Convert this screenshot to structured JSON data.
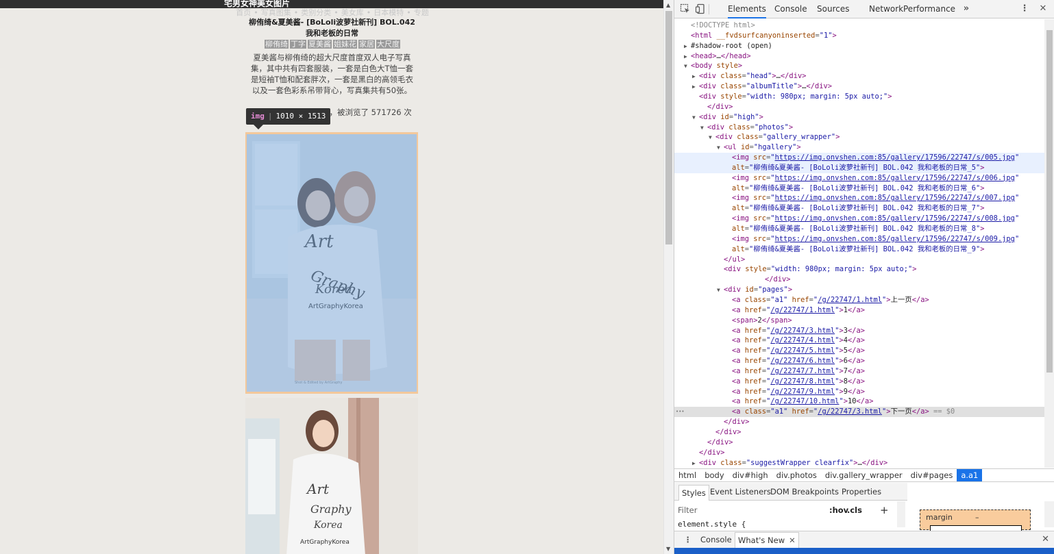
{
  "site": {
    "title": "宅男女神美女图片",
    "nav": [
      "首页",
      "写真图集",
      "类别分类",
      "美女库",
      "日本模特",
      "专题"
    ]
  },
  "album": {
    "title": "柳侑绮&夏美酱- [BoLoli波萝社新刊] BOL.042 我和老板的日常",
    "tags": [
      "柳侑绮",
      "丁字",
      "夏美酱",
      "姐妹花",
      "家居",
      "大尺度"
    ],
    "description": "夏美酱与柳侑绮的超大尺度首度双人电子写真集，其中共有四套服装，一套是白色大T恤一套是短袖T恤和配套胖次，一套是黑白的高领毛衣以及一套色彩系吊带背心，写真集共有50张。",
    "meta": "，在 2017/5/17 创建，被浏览了 571726 次"
  },
  "photos": [
    {
      "watermark": "ArtGraphyKorea",
      "credit": "Shot & Edited by ArtGraphy"
    },
    {
      "watermark": "ArtGraphyKorea"
    }
  ],
  "tooltip": {
    "tag": "img",
    "size": "1010 × 1513"
  },
  "devtools": {
    "tabs": [
      "Elements",
      "Console",
      "Sources",
      "Network",
      "Performance"
    ],
    "active_tab": "Elements",
    "more_icon": "»",
    "kebab_icon": "⋮",
    "close_icon": "✕",
    "dom_lines": [
      {
        "indent": 0,
        "tw": "",
        "html": "<span class=\"cm\">&lt;!DOCTYPE html&gt;</span>"
      },
      {
        "indent": 0,
        "tw": "",
        "html": "<span class=\"t\">&lt;html</span> <span class=\"an\">__fvdsurfcanyoninserted</span><span class=\"eq\">=</span><span class=\"av\">\"1\"</span><span class=\"t\">&gt;</span>"
      },
      {
        "indent": 0,
        "tw": "▶",
        "html": "<span class=\"tx\">#shadow-root (open)</span>"
      },
      {
        "indent": 0,
        "tw": "▶",
        "html": "<span class=\"t\">&lt;head&gt;</span><span class=\"tx\">…</span><span class=\"t\">&lt;/head&gt;</span>"
      },
      {
        "indent": 0,
        "tw": "▼",
        "html": "<span class=\"t\">&lt;body</span> <span class=\"an\">style</span><span class=\"t\">&gt;</span>"
      },
      {
        "indent": 1,
        "tw": "▶",
        "html": "<span class=\"t\">&lt;div</span> <span class=\"an\">class</span><span class=\"eq\">=</span><span class=\"av\">\"head\"</span><span class=\"t\">&gt;</span><span class=\"tx\">…</span><span class=\"t\">&lt;/div&gt;</span>"
      },
      {
        "indent": 1,
        "tw": "▶",
        "html": "<span class=\"t\">&lt;div</span> <span class=\"an\">class</span><span class=\"eq\">=</span><span class=\"av\">\"albumTitle\"</span><span class=\"t\">&gt;</span><span class=\"tx\">…</span><span class=\"t\">&lt;/div&gt;</span>"
      },
      {
        "indent": 1,
        "tw": "",
        "html": "<span class=\"t\">&lt;div</span> <span class=\"an\">style</span><span class=\"eq\">=</span><span class=\"av\">\"width: 980px; margin: 5px auto;\"</span><span class=\"t\">&gt;</span>"
      },
      {
        "indent": 2,
        "tw": "",
        "html": "<span class=\"t\">&lt;/div&gt;</span>"
      },
      {
        "indent": 1,
        "tw": "▼",
        "html": "<span class=\"t\">&lt;div</span> <span class=\"an\">id</span><span class=\"eq\">=</span><span class=\"av\">\"high\"</span><span class=\"t\">&gt;</span>"
      },
      {
        "indent": 2,
        "tw": "▼",
        "html": "<span class=\"t\">&lt;div</span> <span class=\"an\">class</span><span class=\"eq\">=</span><span class=\"av\">\"photos\"</span><span class=\"t\">&gt;</span>"
      },
      {
        "indent": 3,
        "tw": "▼",
        "html": "<span class=\"t\">&lt;div</span> <span class=\"an\">class</span><span class=\"eq\">=</span><span class=\"av\">\"gallery_wrapper\"</span><span class=\"t\">&gt;</span>"
      },
      {
        "indent": 4,
        "tw": "▼",
        "html": "<span class=\"t\">&lt;ul</span> <span class=\"an\">id</span><span class=\"eq\">=</span><span class=\"av\">\"hgallery\"</span><span class=\"t\">&gt;</span>"
      },
      {
        "indent": 5,
        "tw": "",
        "hov": true,
        "html": "<span class=\"t\">&lt;img</span> <span class=\"an\">src</span><span class=\"eq\">=</span><span class=\"av\">\"</span><span class=\"lk\">https://img.onvshen.com:85/gallery/17596/22747/s/005.jpg</span><span class=\"av\">\"</span>"
      },
      {
        "indent": 5,
        "tw": "",
        "hov": true,
        "html": "<span class=\"an\">alt</span><span class=\"eq\">=</span><span class=\"av\">\"柳侑绮&amp;夏美酱- [BoLoli波萝社新刊] BOL.042 我和老板的日常_5\"</span><span class=\"t\">&gt;</span>"
      },
      {
        "indent": 5,
        "tw": "",
        "html": "<span class=\"t\">&lt;img</span> <span class=\"an\">src</span><span class=\"eq\">=</span><span class=\"av\">\"</span><span class=\"lk\">https://img.onvshen.com:85/gallery/17596/22747/s/006.jpg</span><span class=\"av\">\"</span>"
      },
      {
        "indent": 5,
        "tw": "",
        "html": "<span class=\"an\">alt</span><span class=\"eq\">=</span><span class=\"av\">\"柳侑绮&amp;夏美酱- [BoLoli波萝社新刊] BOL.042 我和老板的日常_6\"</span><span class=\"t\">&gt;</span>"
      },
      {
        "indent": 5,
        "tw": "",
        "html": "<span class=\"t\">&lt;img</span> <span class=\"an\">src</span><span class=\"eq\">=</span><span class=\"av\">\"</span><span class=\"lk\">https://img.onvshen.com:85/gallery/17596/22747/s/007.jpg</span><span class=\"av\">\"</span>"
      },
      {
        "indent": 5,
        "tw": "",
        "html": "<span class=\"an\">alt</span><span class=\"eq\">=</span><span class=\"av\">\"柳侑绮&amp;夏美酱- [BoLoli波萝社新刊] BOL.042 我和老板的日常_7\"</span><span class=\"t\">&gt;</span>"
      },
      {
        "indent": 5,
        "tw": "",
        "html": "<span class=\"t\">&lt;img</span> <span class=\"an\">src</span><span class=\"eq\">=</span><span class=\"av\">\"</span><span class=\"lk\">https://img.onvshen.com:85/gallery/17596/22747/s/008.jpg</span><span class=\"av\">\"</span>"
      },
      {
        "indent": 5,
        "tw": "",
        "html": "<span class=\"an\">alt</span><span class=\"eq\">=</span><span class=\"av\">\"柳侑绮&amp;夏美酱- [BoLoli波萝社新刊] BOL.042 我和老板的日常_8\"</span><span class=\"t\">&gt;</span>"
      },
      {
        "indent": 5,
        "tw": "",
        "html": "<span class=\"t\">&lt;img</span> <span class=\"an\">src</span><span class=\"eq\">=</span><span class=\"av\">\"</span><span class=\"lk\">https://img.onvshen.com:85/gallery/17596/22747/s/009.jpg</span><span class=\"av\">\"</span>"
      },
      {
        "indent": 5,
        "tw": "",
        "html": "<span class=\"an\">alt</span><span class=\"eq\">=</span><span class=\"av\">\"柳侑绮&amp;夏美酱- [BoLoli波萝社新刊] BOL.042 我和老板的日常_9\"</span><span class=\"t\">&gt;</span>"
      },
      {
        "indent": 4,
        "tw": "",
        "html": "<span class=\"t\">&lt;/ul&gt;</span>"
      },
      {
        "indent": 4,
        "tw": "",
        "html": "<span class=\"t\">&lt;div</span> <span class=\"an\">style</span><span class=\"eq\">=</span><span class=\"av\">\"width: 980px; margin: 5px auto;\"</span><span class=\"t\">&gt;</span>"
      },
      {
        "indent": 9,
        "tw": "",
        "html": "<span class=\"t\">&lt;/div&gt;</span>"
      },
      {
        "indent": 4,
        "tw": "▼",
        "html": "<span class=\"t\">&lt;div</span> <span class=\"an\">id</span><span class=\"eq\">=</span><span class=\"av\">\"pages\"</span><span class=\"t\">&gt;</span>"
      },
      {
        "indent": 5,
        "tw": "",
        "html": "<span class=\"t\">&lt;a</span> <span class=\"an\">class</span><span class=\"eq\">=</span><span class=\"av\">\"a1\"</span> <span class=\"an\">href</span><span class=\"eq\">=</span><span class=\"av\">\"</span><span class=\"lk\">/g/22747/1.html</span><span class=\"av\">\"</span><span class=\"t\">&gt;</span><span class=\"tx\">上一页</span><span class=\"t\">&lt;/a&gt;</span>"
      },
      {
        "indent": 5,
        "tw": "",
        "html": "<span class=\"t\">&lt;a</span> <span class=\"an\">href</span><span class=\"eq\">=</span><span class=\"av\">\"</span><span class=\"lk\">/g/22747/1.html</span><span class=\"av\">\"</span><span class=\"t\">&gt;</span><span class=\"tx\">1</span><span class=\"t\">&lt;/a&gt;</span>"
      },
      {
        "indent": 5,
        "tw": "",
        "html": "<span class=\"t\">&lt;span&gt;</span><span class=\"tx\">2</span><span class=\"t\">&lt;/span&gt;</span>"
      },
      {
        "indent": 5,
        "tw": "",
        "html": "<span class=\"t\">&lt;a</span> <span class=\"an\">href</span><span class=\"eq\">=</span><span class=\"av\">\"</span><span class=\"lk\">/g/22747/3.html</span><span class=\"av\">\"</span><span class=\"t\">&gt;</span><span class=\"tx\">3</span><span class=\"t\">&lt;/a&gt;</span>"
      },
      {
        "indent": 5,
        "tw": "",
        "html": "<span class=\"t\">&lt;a</span> <span class=\"an\">href</span><span class=\"eq\">=</span><span class=\"av\">\"</span><span class=\"lk\">/g/22747/4.html</span><span class=\"av\">\"</span><span class=\"t\">&gt;</span><span class=\"tx\">4</span><span class=\"t\">&lt;/a&gt;</span>"
      },
      {
        "indent": 5,
        "tw": "",
        "html": "<span class=\"t\">&lt;a</span> <span class=\"an\">href</span><span class=\"eq\">=</span><span class=\"av\">\"</span><span class=\"lk\">/g/22747/5.html</span><span class=\"av\">\"</span><span class=\"t\">&gt;</span><span class=\"tx\">5</span><span class=\"t\">&lt;/a&gt;</span>"
      },
      {
        "indent": 5,
        "tw": "",
        "html": "<span class=\"t\">&lt;a</span> <span class=\"an\">href</span><span class=\"eq\">=</span><span class=\"av\">\"</span><span class=\"lk\">/g/22747/6.html</span><span class=\"av\">\"</span><span class=\"t\">&gt;</span><span class=\"tx\">6</span><span class=\"t\">&lt;/a&gt;</span>"
      },
      {
        "indent": 5,
        "tw": "",
        "html": "<span class=\"t\">&lt;a</span> <span class=\"an\">href</span><span class=\"eq\">=</span><span class=\"av\">\"</span><span class=\"lk\">/g/22747/7.html</span><span class=\"av\">\"</span><span class=\"t\">&gt;</span><span class=\"tx\">7</span><span class=\"t\">&lt;/a&gt;</span>"
      },
      {
        "indent": 5,
        "tw": "",
        "html": "<span class=\"t\">&lt;a</span> <span class=\"an\">href</span><span class=\"eq\">=</span><span class=\"av\">\"</span><span class=\"lk\">/g/22747/8.html</span><span class=\"av\">\"</span><span class=\"t\">&gt;</span><span class=\"tx\">8</span><span class=\"t\">&lt;/a&gt;</span>"
      },
      {
        "indent": 5,
        "tw": "",
        "html": "<span class=\"t\">&lt;a</span> <span class=\"an\">href</span><span class=\"eq\">=</span><span class=\"av\">\"</span><span class=\"lk\">/g/22747/9.html</span><span class=\"av\">\"</span><span class=\"t\">&gt;</span><span class=\"tx\">9</span><span class=\"t\">&lt;/a&gt;</span>"
      },
      {
        "indent": 5,
        "tw": "",
        "html": "<span class=\"t\">&lt;a</span> <span class=\"an\">href</span><span class=\"eq\">=</span><span class=\"av\">\"</span><span class=\"lk\">/g/22747/10.html</span><span class=\"av\">\"</span><span class=\"t\">&gt;</span><span class=\"tx\">10</span><span class=\"t\">&lt;/a&gt;</span>"
      },
      {
        "indent": 5,
        "tw": "",
        "sel": true,
        "html": "<span class=\"t\">&lt;a</span> <span class=\"an\">class</span><span class=\"eq\">=</span><span class=\"av\">\"a1\"</span> <span class=\"an\">href</span><span class=\"eq\">=</span><span class=\"av\">\"</span><span class=\"lk\">/g/22747/3.html</span><span class=\"av\">\"</span><span class=\"t\">&gt;</span><span class=\"tx\">下一页</span><span class=\"t\">&lt;/a&gt;</span> <span class=\"cm\">== $0</span>"
      },
      {
        "indent": 4,
        "tw": "",
        "html": "<span class=\"t\">&lt;/div&gt;</span>"
      },
      {
        "indent": 3,
        "tw": "",
        "html": "<span class=\"t\">&lt;/div&gt;</span>"
      },
      {
        "indent": 2,
        "tw": "",
        "html": "<span class=\"t\">&lt;/div&gt;</span>"
      },
      {
        "indent": 1,
        "tw": "",
        "html": "<span class=\"t\">&lt;/div&gt;</span>"
      },
      {
        "indent": 1,
        "tw": "▶",
        "html": "<span class=\"t\">&lt;div</span> <span class=\"an\">class</span><span class=\"eq\">=</span><span class=\"av\">\"suggestWrapper clearfix\"</span><span class=\"t\">&gt;</span><span class=\"tx\">…</span><span class=\"t\">&lt;/div&gt;</span>"
      }
    ],
    "selected_ellipsis": "•••",
    "breadcrumbs": [
      "html",
      "body",
      "div#high",
      "div.photos",
      "div.gallery_wrapper",
      "div#pages",
      "a.a1"
    ],
    "styles_tabs": [
      "Styles",
      "Event Listeners",
      "DOM Breakpoints",
      "Properties"
    ],
    "filter_placeholder": "Filter",
    "hov_label": ":hov",
    "cls_label": ".cls",
    "plus_label": "+",
    "element_style": "element.style {",
    "box_model": {
      "label": "margin",
      "value": "–"
    },
    "drawer_tabs": [
      "Console",
      "What's New"
    ]
  }
}
